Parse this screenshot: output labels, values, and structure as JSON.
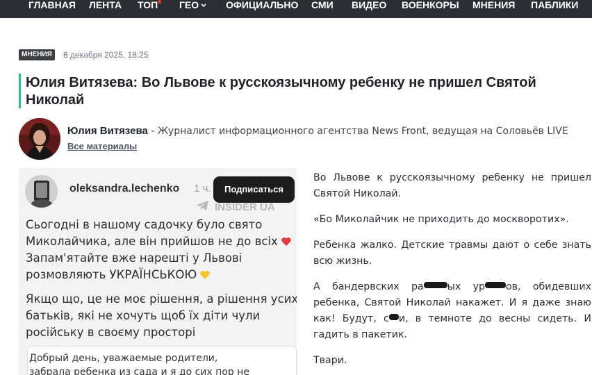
{
  "nav": {
    "items": [
      {
        "label": "ГЛАВНАЯ"
      },
      {
        "label": "ЛЕНТА"
      },
      {
        "label": "ТОП"
      },
      {
        "label": "ГЕО"
      },
      {
        "label": "ОФИЦИАЛЬНО"
      },
      {
        "label": "СМИ"
      },
      {
        "label": "ВИДЕО"
      },
      {
        "label": "ВОЕНКОРЫ"
      },
      {
        "label": "МНЕНИЯ"
      },
      {
        "label": "ПАБЛИКИ"
      }
    ]
  },
  "article": {
    "tag": "МНЕНИЯ",
    "date": "8 декабря 2025, 18:25",
    "title": "Юлия Витязева: Во Львове к русскоязычному ребенку не пришел Святой Николай",
    "author": {
      "name": "Юлия Витязева",
      "description": " - Журналист информационного агентства News Front, ведущая на Соловьёв LIVE",
      "all_materials": "Все материалы"
    },
    "body": {
      "p1": "Во Львове к русскоязычному ребенку не пришел Святой Николай.",
      "p2": "«Бо Миколайчик не приходить до москворотих».",
      "p3": "Ребенка жалко. Детские травмы дают о себе знать всю жизнь.",
      "p4_part1": "А бандервских ра",
      "p4_part2": "ых ур",
      "p4_part3": "ов, обидевших ребенка, Святой Николай накажет. И я даже знаю как! Будут, с",
      "p4_part4": "и, в темноте до весны сидеть. И гадить в пакетик.",
      "p5": "Твари."
    }
  },
  "screenshot": {
    "username": "oleksandra.lechenko",
    "time": "1 ч.",
    "subscribe_label": "Подписаться",
    "watermark": "INSIDER UA",
    "para1": [
      "Сьогодні в нашому садочку було свято",
      "Миколайчика, але він прийшов не до всіх",
      "Запам'ятайте вже нарешті у Львові",
      "розмовляють УКРАЇНСЬКОЮ"
    ],
    "para2": [
      "Якщо що, це не моє рішення, а рішення усих",
      "батьків, які не хочуть щоб їх діти чули",
      "російську в своєму просторі"
    ],
    "card": [
      "Добрый день, уважаемые родители,",
      "забрала ребенка из сада и я до сих пор не"
    ]
  },
  "colors": {
    "nav_bg": "#2a2f35",
    "accent_bar": "#2bbf8d",
    "tag_bg": "#3b3f44"
  }
}
